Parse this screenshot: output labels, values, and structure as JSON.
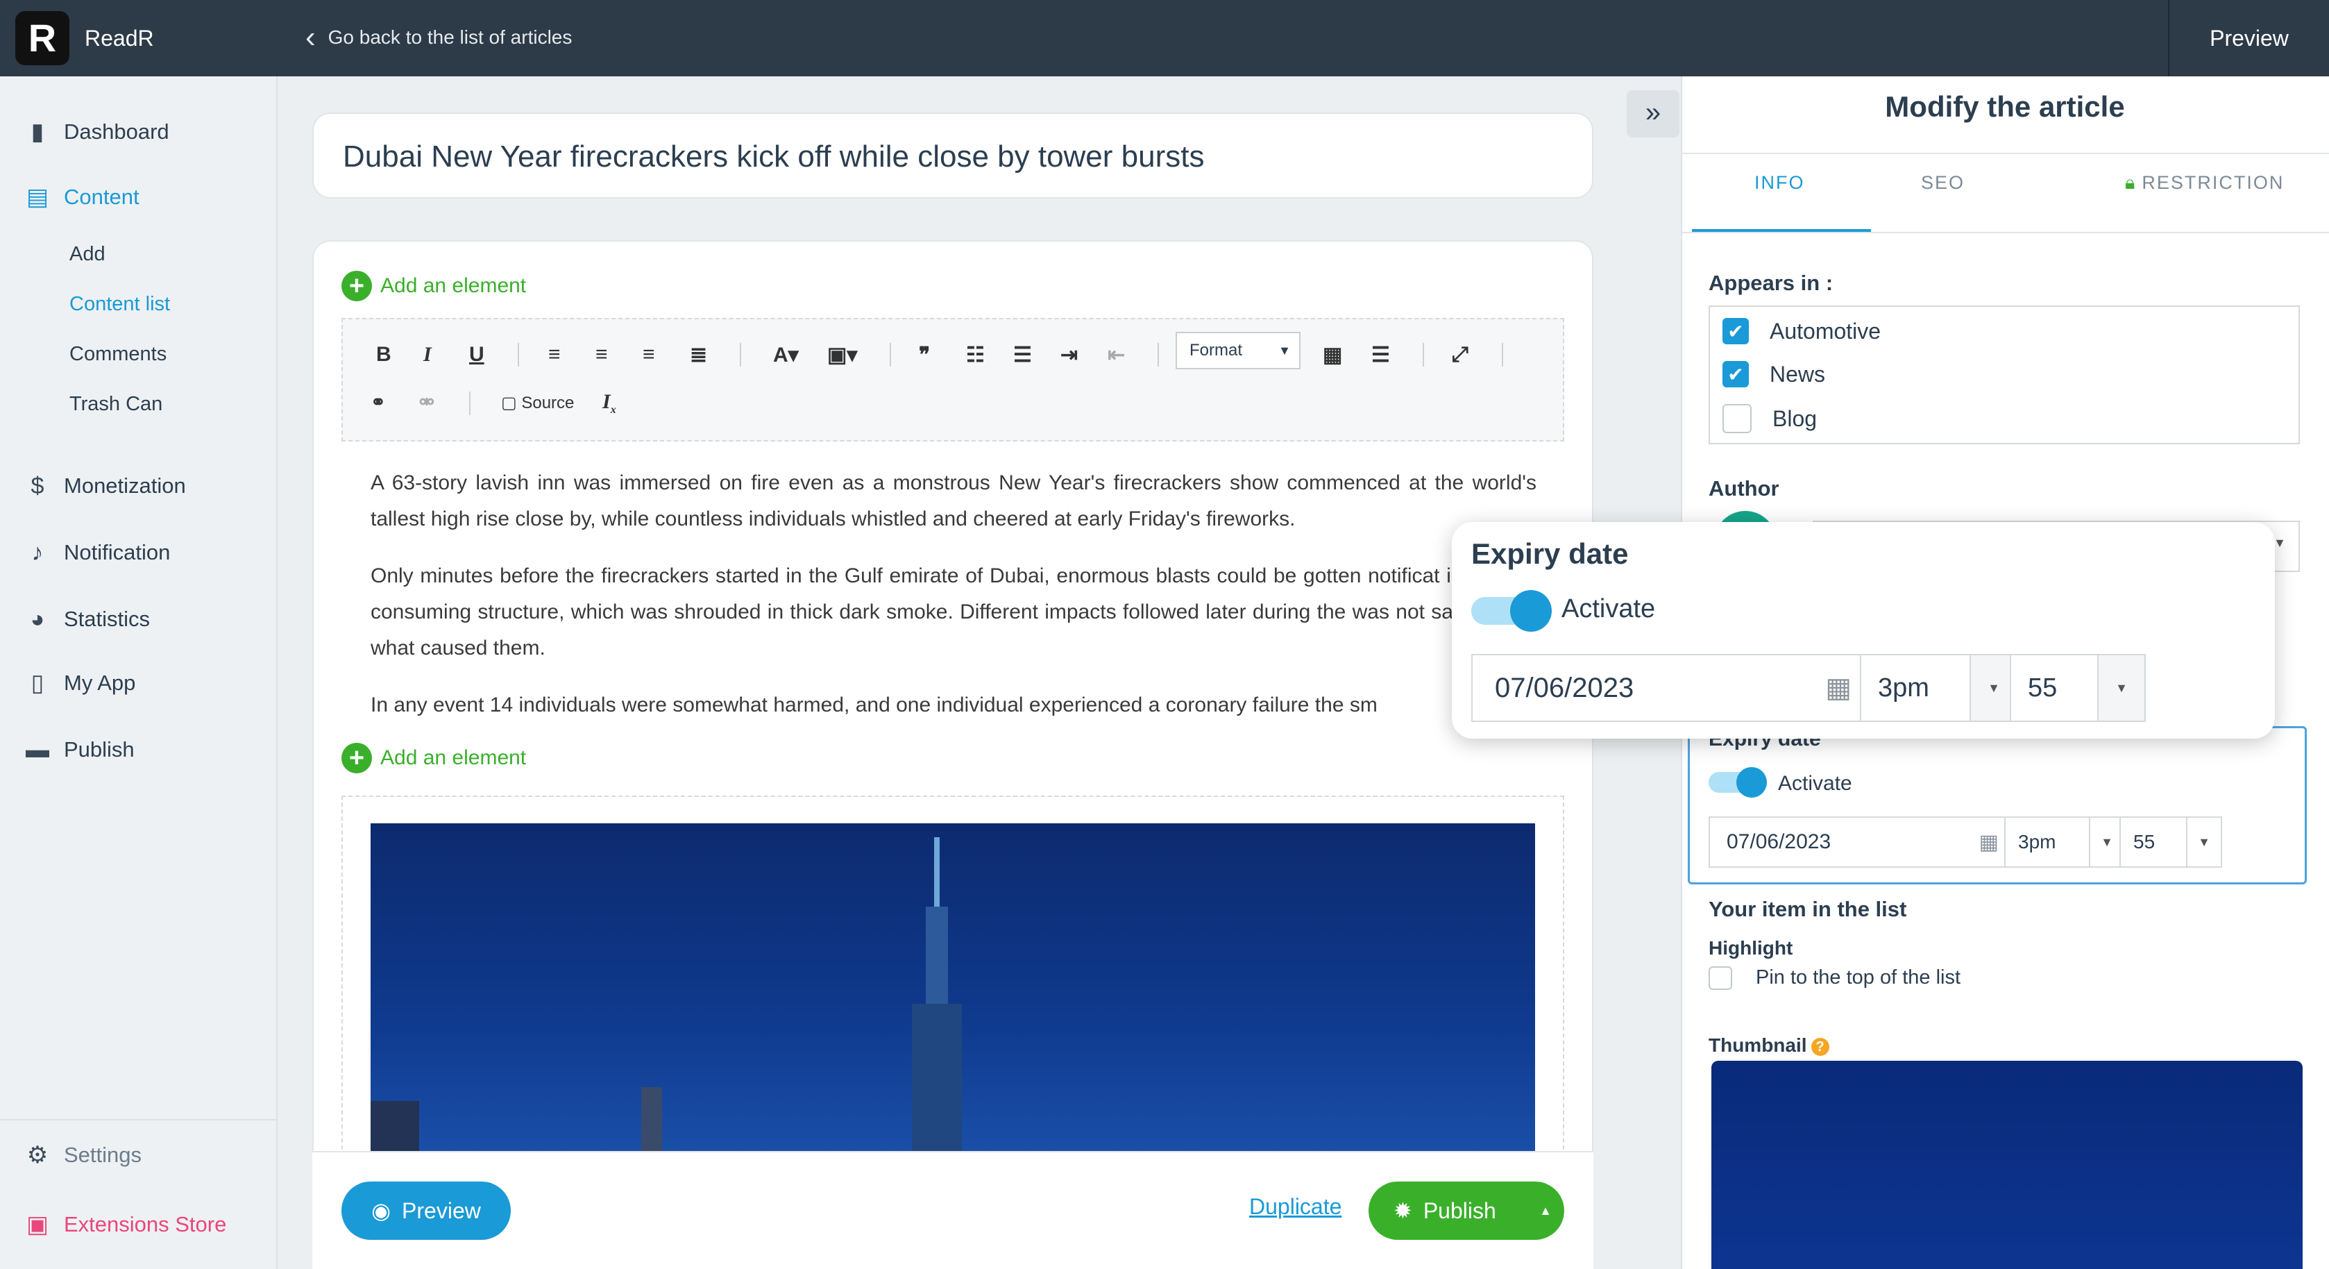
{
  "topbar": {
    "app_name": "ReadR",
    "logo_letter": "R",
    "back_label": "Go back to the list of articles",
    "preview_label": "Preview"
  },
  "sidebar": {
    "items": [
      {
        "label": "Dashboard",
        "icon": "bar-chart-icon"
      },
      {
        "label": "Content",
        "icon": "document-icon"
      },
      {
        "label": "Monetization",
        "icon": "dollar-icon"
      },
      {
        "label": "Notification",
        "icon": "bell-icon"
      },
      {
        "label": "Statistics",
        "icon": "pie-chart-icon"
      },
      {
        "label": "My App",
        "icon": "phone-icon"
      },
      {
        "label": "Publish",
        "icon": "publish-icon"
      }
    ],
    "content_sub": [
      "Add",
      "Content list",
      "Comments",
      "Trash Can"
    ],
    "settings_label": "Settings",
    "store_label": "Extensions Store"
  },
  "editor": {
    "title": "Dubai New Year firecrackers kick off while close by tower bursts",
    "add_element_label": "Add an element",
    "format_label": "Format",
    "source_label": "Source",
    "paragraphs": [
      "A 63-story lavish inn was immersed on fire even as a monstrous New Year's firecrackers show commenced at the world's tallest high rise close by, while countless individuals whistled and cheered at early Friday's fireworks.",
      "Only minutes before the firecrackers started in the Gulf emirate of Dubai, enormous blasts could be gotten notificat inside the consuming structure, which was shrouded in thick dark smoke. Different impacts followed later during the was not satisfactory what caused them.",
      "In any event 14 individuals were somewhat harmed, and one individual experienced a coronary failure the sm"
    ]
  },
  "footer": {
    "preview_label": "Preview",
    "duplicate_label": "Duplicate",
    "publish_label": "Publish"
  },
  "panel": {
    "title": "Modify the article",
    "tabs": [
      "INFO",
      "SEO",
      "RESTRICTION"
    ],
    "appears_label": "Appears in :",
    "categories": [
      {
        "label": "Automotive",
        "checked": true
      },
      {
        "label": "News",
        "checked": true
      },
      {
        "label": "Blog",
        "checked": false
      }
    ],
    "author_label": "Author",
    "expiry": {
      "title": "Expiry date",
      "activate_label": "Activate",
      "date": "07/06/2023",
      "hour": "3pm",
      "minute": "55"
    },
    "list_section_label": "Your item in the list",
    "highlight_label": "Highlight",
    "pin_label": "Pin to the top of the list",
    "thumbnail_label": "Thumbnail"
  },
  "colors": {
    "accent": "#1a9ad6",
    "green": "#3ab02a",
    "topbar": "#2d3a48",
    "store": "#e9467b"
  }
}
